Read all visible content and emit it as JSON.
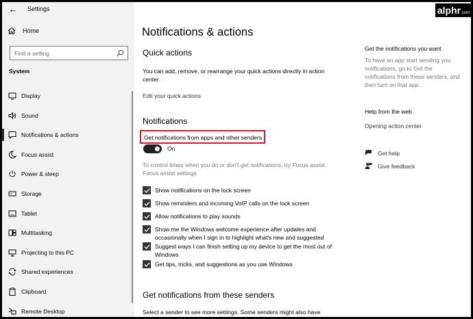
{
  "window": {
    "title": "Settings"
  },
  "sidebar": {
    "home_label": "Home",
    "search_placeholder": "Find a setting",
    "section_label": "System",
    "items": [
      {
        "label": "Display",
        "icon": "display-icon"
      },
      {
        "label": "Sound",
        "icon": "speaker-icon"
      },
      {
        "label": "Notifications & actions",
        "icon": "notification-icon",
        "active": true
      },
      {
        "label": "Focus assist",
        "icon": "moon-icon"
      },
      {
        "label": "Power & sleep",
        "icon": "power-icon"
      },
      {
        "label": "Storage",
        "icon": "storage-icon"
      },
      {
        "label": "Tablet",
        "icon": "tablet-icon"
      },
      {
        "label": "Multitasking",
        "icon": "multitasking-icon"
      },
      {
        "label": "Projecting to this PC",
        "icon": "projector-icon"
      },
      {
        "label": "Shared experiences",
        "icon": "shared-icon"
      },
      {
        "label": "Clipboard",
        "icon": "clipboard-icon"
      },
      {
        "label": "Remote Desktop",
        "icon": "remote-desktop-icon"
      }
    ]
  },
  "main": {
    "page_title": "Notifications & actions",
    "quick_actions": {
      "heading": "Quick actions",
      "description": "You can add, remove, or rearrange your quick actions directly in action center.",
      "edit_link": "Edit your quick actions"
    },
    "notifications": {
      "heading": "Notifications",
      "highlighted_setting": "Get notifications from apps and other senders",
      "toggle_state": "On",
      "focus_text": "To control times when you do or don't get notifications, try Focus assist.",
      "focus_link": "Focus assist settings",
      "checkboxes": [
        {
          "label": "Show notifications on the lock screen",
          "checked": true
        },
        {
          "label": "Show reminders and incoming VoIP calls on the lock screen",
          "checked": true
        },
        {
          "label": "Allow notifications to play sounds",
          "checked": true
        },
        {
          "label": "Show me the Windows welcome experience after updates and occasionally when I sign in to highlight what's new and suggested",
          "checked": true
        },
        {
          "label": "Suggest ways I can finish setting up my device to get the most out of Windows",
          "checked": true
        },
        {
          "label": "Get tips, tricks, and suggestions as you use Windows",
          "checked": true
        }
      ]
    },
    "senders": {
      "heading": "Get notifications from these senders",
      "description": "Select a sender to see more settings. Some senders might also have"
    }
  },
  "right_column": {
    "get_notifications_heading": "Get the notifications you want",
    "get_notifications_text": "To have an app start sending you notifications, go to Get the notifications from these senders, and then turn on that app.",
    "help_heading": "Help from the web",
    "help_link": "Opening action center",
    "get_help": "Get help",
    "give_feedback": "Give feedback"
  },
  "watermark": {
    "brand": "alphr",
    "suffix": ".com"
  },
  "colors": {
    "highlight_border": "#e0141e",
    "toggle_on": "#222222",
    "checkbox": "#333333"
  }
}
